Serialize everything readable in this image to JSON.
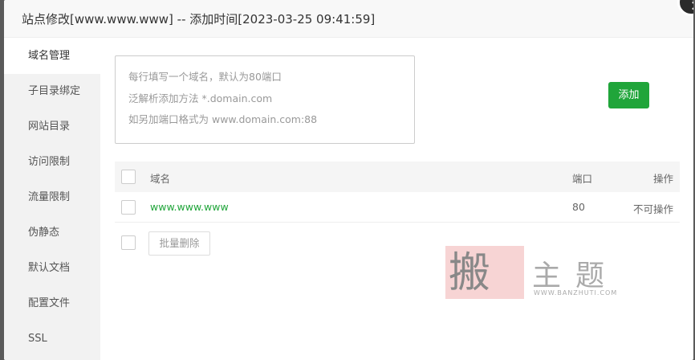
{
  "dialog": {
    "title": "站点修改[www.www.www] -- 添加时间[2023-03-25 09:41:59]"
  },
  "sidebar": {
    "items": [
      {
        "label": "域名管理",
        "active": true
      },
      {
        "label": "子目录绑定"
      },
      {
        "label": "网站目录"
      },
      {
        "label": "访问限制"
      },
      {
        "label": "流量限制"
      },
      {
        "label": "伪静态"
      },
      {
        "label": "默认文档"
      },
      {
        "label": "配置文件"
      },
      {
        "label": "SSL"
      }
    ]
  },
  "domain_form": {
    "hints": [
      "每行填写一个域名，默认为80端口",
      "泛解析添加方法 *.domain.com",
      "如另加端口格式为 www.domain.com:88"
    ],
    "add_label": "添加"
  },
  "table": {
    "headers": {
      "domain": "域名",
      "port": "端口",
      "action": "操作"
    },
    "rows": [
      {
        "domain": "www.www.www",
        "port": "80",
        "action": "不可操作"
      }
    ]
  },
  "batch_delete_label": "批量删除",
  "watermark": {
    "brand_char": "搬",
    "brand_rest": "主题",
    "url": "WWW.BANZHUTI.COM"
  },
  "colors": {
    "accent": "#20a53a"
  }
}
